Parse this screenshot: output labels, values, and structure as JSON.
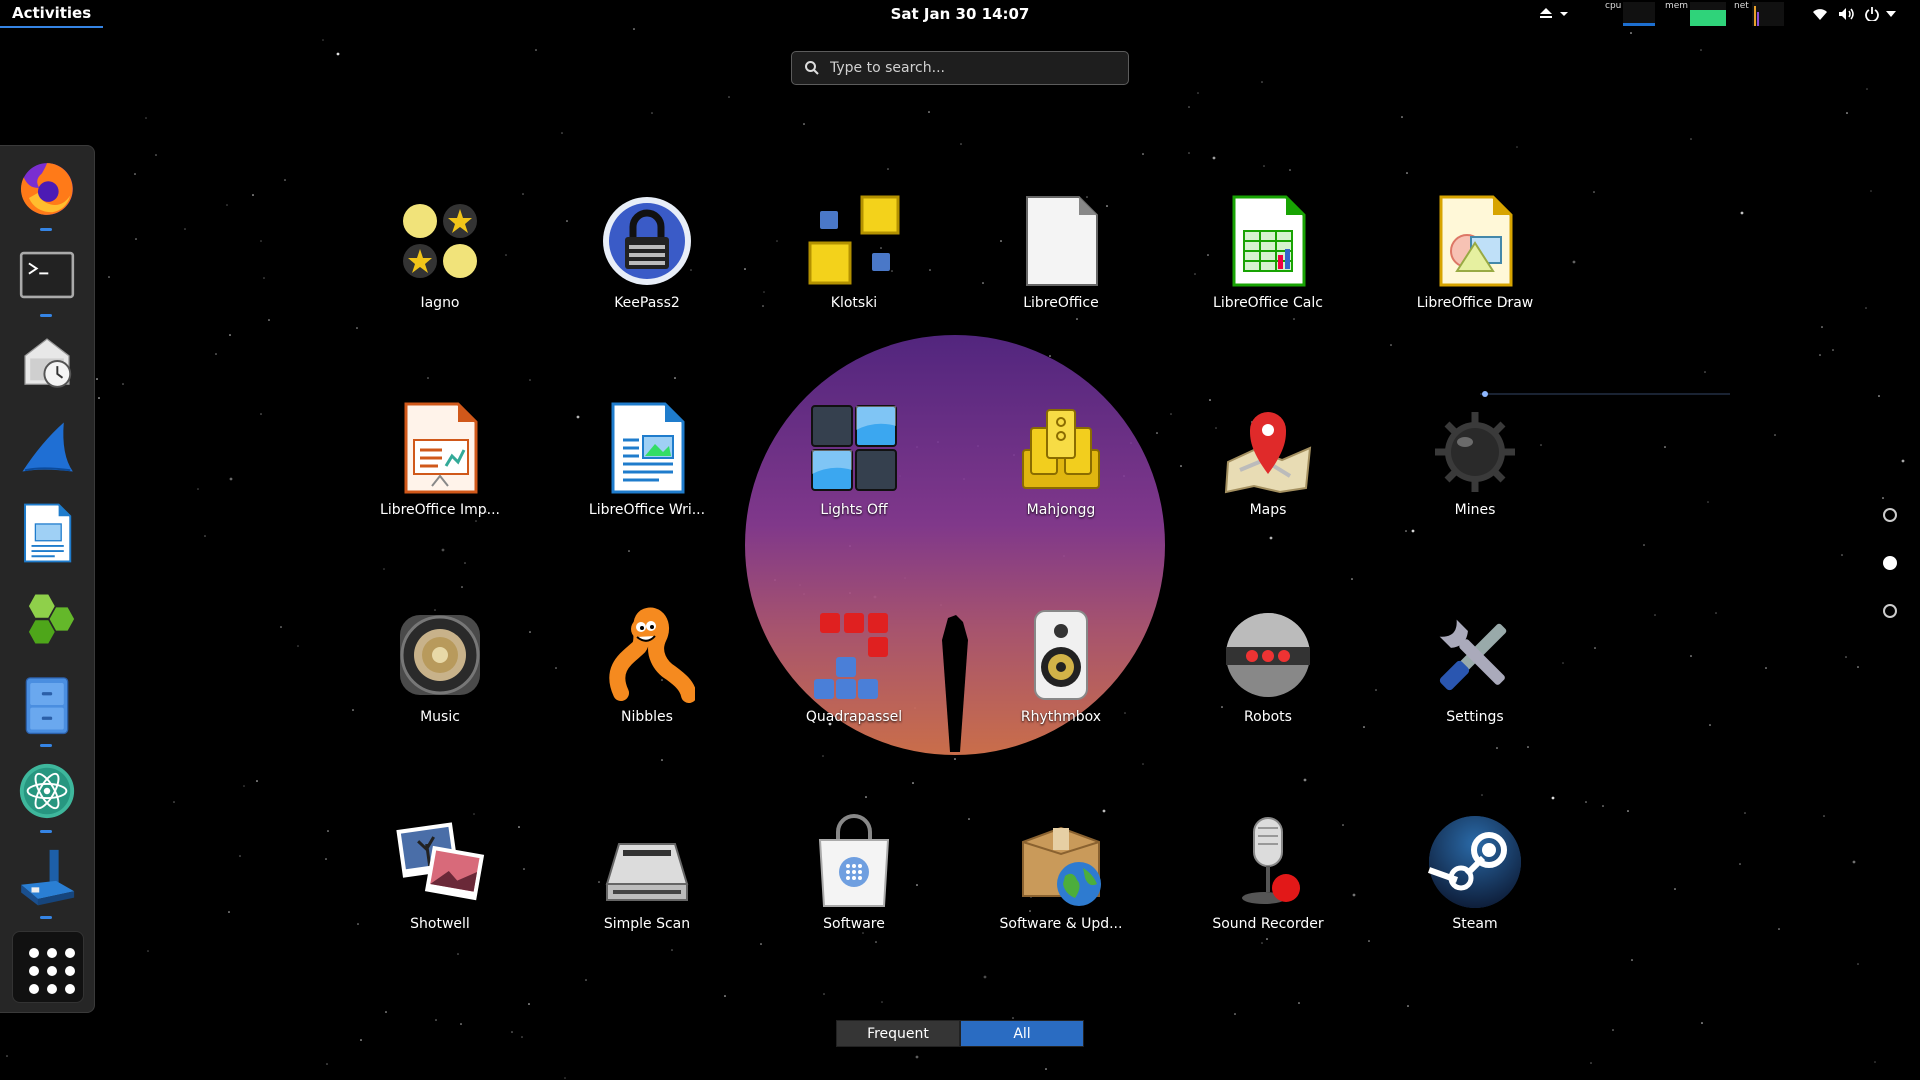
{
  "topbar": {
    "activities": "Activities",
    "clock": "Sat Jan 30  14:07",
    "graphs": [
      {
        "label": "cpu",
        "color": "#1d6fd0"
      },
      {
        "label": "mem",
        "color": "#2fd37a"
      },
      {
        "label": "net",
        "color": "#e8a02b"
      }
    ]
  },
  "search": {
    "placeholder": "Type to search..."
  },
  "dash": {
    "items": [
      {
        "name": "firefox-icon",
        "running": true
      },
      {
        "name": "terminal-icon",
        "running": true
      },
      {
        "name": "backup-icon",
        "running": false
      },
      {
        "name": "wireshark-icon",
        "running": false
      },
      {
        "name": "libreoffice-writer-icon",
        "running": false
      },
      {
        "name": "hexagons-icon",
        "running": false
      },
      {
        "name": "file-cabinet-icon",
        "running": true
      },
      {
        "name": "atom-icon",
        "running": true
      },
      {
        "name": "virtualbox-icon",
        "running": true
      }
    ],
    "show_apps": "show-applications-icon"
  },
  "apps": [
    {
      "label": "Iagno",
      "icon": "iagno-icon"
    },
    {
      "label": "KeePass2",
      "icon": "keepass-icon"
    },
    {
      "label": "Klotski",
      "icon": "klotski-icon"
    },
    {
      "label": "LibreOffice",
      "icon": "libreoffice-icon"
    },
    {
      "label": "LibreOffice Calc",
      "icon": "libreoffice-calc-icon"
    },
    {
      "label": "LibreOffice Draw",
      "icon": "libreoffice-draw-icon"
    },
    {
      "label": "LibreOffice Imp...",
      "icon": "libreoffice-impress-icon"
    },
    {
      "label": "LibreOffice Wri...",
      "icon": "libreoffice-writer-icon"
    },
    {
      "label": "Lights Off",
      "icon": "lights-off-icon"
    },
    {
      "label": "Mahjongg",
      "icon": "mahjongg-icon"
    },
    {
      "label": "Maps",
      "icon": "maps-icon"
    },
    {
      "label": "Mines",
      "icon": "mines-icon"
    },
    {
      "label": "Music",
      "icon": "music-icon"
    },
    {
      "label": "Nibbles",
      "icon": "nibbles-icon"
    },
    {
      "label": "Quadrapassel",
      "icon": "quadrapassel-icon"
    },
    {
      "label": "Rhythmbox",
      "icon": "rhythmbox-icon"
    },
    {
      "label": "Robots",
      "icon": "robots-icon"
    },
    {
      "label": "Settings",
      "icon": "settings-icon"
    },
    {
      "label": "Shotwell",
      "icon": "shotwell-icon"
    },
    {
      "label": "Simple Scan",
      "icon": "simple-scan-icon"
    },
    {
      "label": "Software",
      "icon": "software-icon"
    },
    {
      "label": "Software & Upd...",
      "icon": "software-updates-icon"
    },
    {
      "label": "Sound Recorder",
      "icon": "sound-recorder-icon"
    },
    {
      "label": "Steam",
      "icon": "steam-icon"
    }
  ],
  "pages": {
    "count": 3,
    "current": 2
  },
  "view_toggle": {
    "frequent": "Frequent",
    "all": "All",
    "selected": "All"
  }
}
